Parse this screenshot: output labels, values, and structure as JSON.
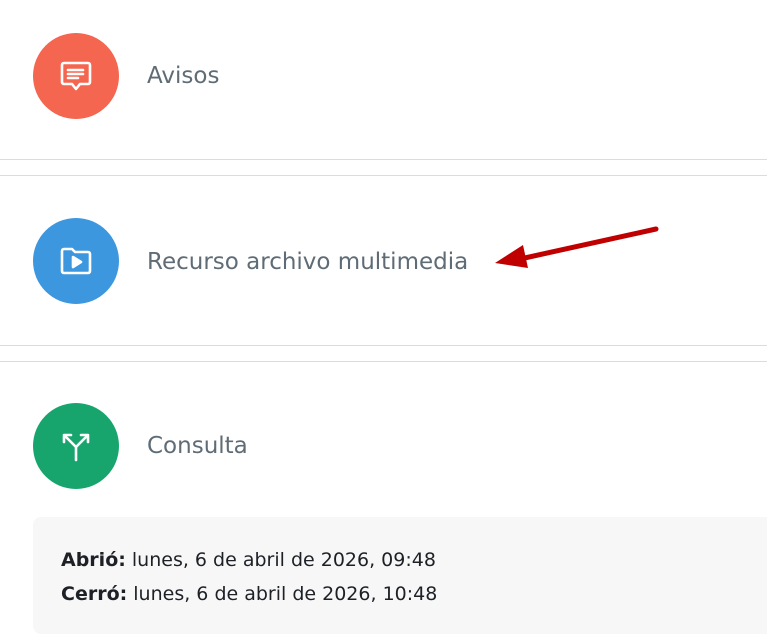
{
  "activities": [
    {
      "name": "Avisos",
      "icon": "forum-icon",
      "color": "#f4664f"
    },
    {
      "name": "Recurso archivo multimedia",
      "icon": "folder-play-icon",
      "color": "#3d97df"
    },
    {
      "name": "Consulta",
      "icon": "choice-icon",
      "color": "#18a56d"
    }
  ],
  "dates": {
    "opened_label": "Abrió:",
    "opened_value": "lunes, 6 de abril de 2026, 09:48",
    "closed_label": "Cerró:",
    "closed_value": "lunes, 6 de abril de 2026, 10:48"
  },
  "annotation": {
    "arrow_color": "#c00000"
  }
}
